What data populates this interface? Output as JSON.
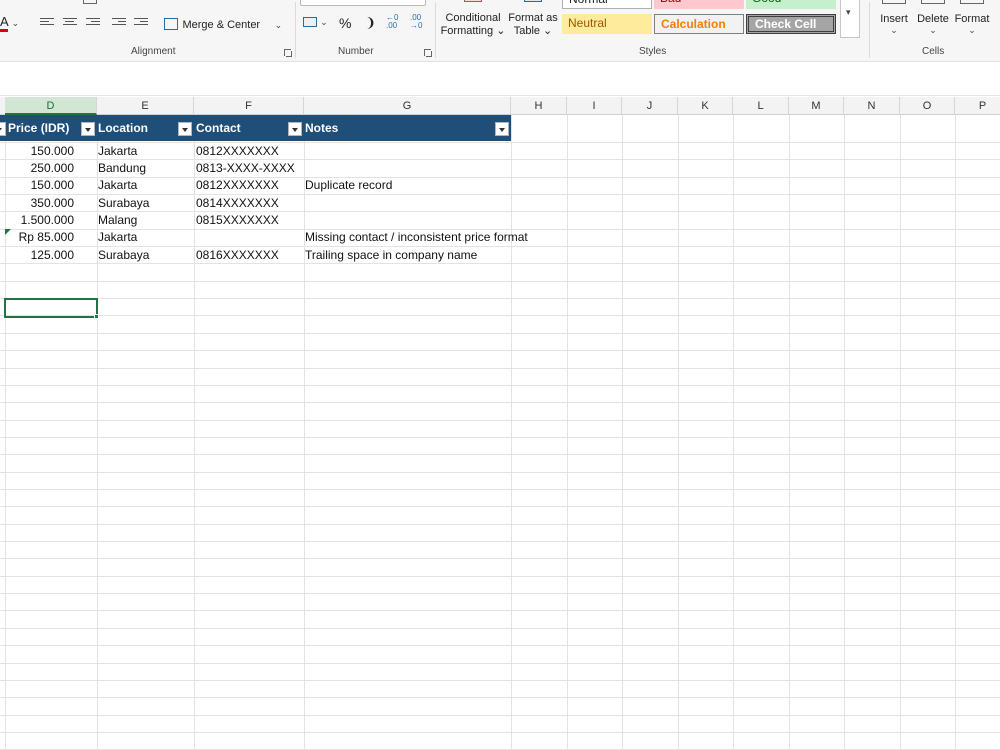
{
  "ribbon": {
    "merge_center_label": "Merge & Center",
    "percent_symbol": "%",
    "comma_symbol": "❩",
    "conditional_formatting_line1": "Conditional",
    "conditional_formatting_line2": "Formatting ⌄",
    "format_as_table_line1": "Format as",
    "format_as_table_line2": "Table ⌄",
    "cell_styles": {
      "normal": "Normal",
      "bad": "Bad",
      "good": "Good",
      "neutral": "Neutral",
      "calculation": "Calculation",
      "check_cell": "Check Cell"
    },
    "insert_label": "Insert",
    "delete_label": "Delete",
    "format_label": "Format",
    "groups": {
      "alignment": "Alignment",
      "number": "Number",
      "styles": "Styles",
      "cells": "Cells"
    }
  },
  "columns": [
    "D",
    "E",
    "F",
    "G",
    "H",
    "I",
    "J",
    "K",
    "L",
    "M",
    "N",
    "O",
    "P"
  ],
  "active_column": "D",
  "table": {
    "headers": [
      "Price (IDR)",
      "Location",
      "Contact",
      "Notes"
    ],
    "rows": [
      {
        "price": "150.000",
        "location": "Jakarta",
        "contact": "0812XXXXXXX",
        "notes": ""
      },
      {
        "price": "250.000",
        "location": "Bandung",
        "contact": "0813-XXXX-XXXX",
        "notes": ""
      },
      {
        "price": "150.000",
        "location": "Jakarta",
        "contact": "0812XXXXXXX",
        "notes": "Duplicate record"
      },
      {
        "price": "350.000",
        "location": "Surabaya",
        "contact": "0814XXXXXXX",
        "notes": ""
      },
      {
        "price": "1.500.000",
        "location": "Malang",
        "contact": "0815XXXXXXX",
        "notes": ""
      },
      {
        "price": "Rp 85.000",
        "location": "Jakarta",
        "contact": "",
        "notes": "Missing contact / inconsistent price format"
      },
      {
        "price": "125.000",
        "location": "Surabaya",
        "contact": "0816XXXXXXX",
        "notes": "Trailing space in company name"
      }
    ]
  },
  "colors": {
    "table_header_bg": "#1f4e79",
    "selection": "#217346",
    "error_indicator": "#107c41"
  }
}
